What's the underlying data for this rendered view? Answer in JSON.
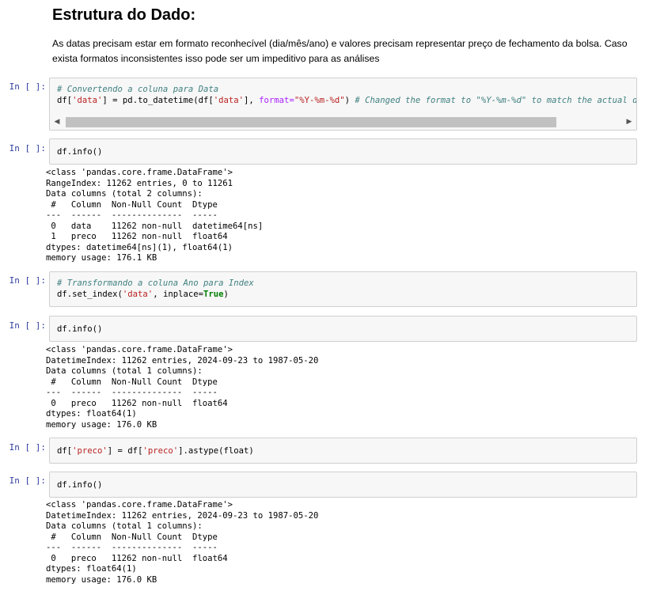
{
  "markdown": {
    "heading": "Estrutura do Dado:",
    "paragraph": "As datas precisam estar em formato reconhecível (dia/mês/ano) e valores precisam representar preço de fechamento da bolsa. Caso exista formatos inconsistentes isso pode ser um impeditivo para as análises"
  },
  "cells": [
    {
      "prompt": "In [ ]:",
      "comment": "# Convertendo a coluna para Data",
      "line2_a": "df[",
      "line2_s1": "'data'",
      "line2_b": "] = pd.to_datetime(df[",
      "line2_s2": "'data'",
      "line2_c": "], ",
      "line2_kw": "format=",
      "line2_s3": "\"%Y-%m-%d\"",
      "line2_d": ") ",
      "line2_comment": "# Changed the format to \"%Y-%m-%d\" to match the actual date format"
    },
    {
      "prompt": "In [ ]:",
      "code": "df.info()",
      "output": "<class 'pandas.core.frame.DataFrame'>\nRangeIndex: 11262 entries, 0 to 11261\nData columns (total 2 columns):\n #   Column  Non-Null Count  Dtype\n---  ------  --------------  -----\n 0   data    11262 non-null  datetime64[ns]\n 1   preco   11262 non-null  float64\ndtypes: datetime64[ns](1), float64(1)\nmemory usage: 176.1 KB"
    },
    {
      "prompt": "In [ ]:",
      "comment": "# Transformando a coluna Ano para Index",
      "line2_a": "df.set_index(",
      "line2_s1": "'data'",
      "line2_b": ", inplace=",
      "line2_bool": "True",
      "line2_c": ")"
    },
    {
      "prompt": "In [ ]:",
      "code": "df.info()",
      "output": "<class 'pandas.core.frame.DataFrame'>\nDatetimeIndex: 11262 entries, 2024-09-23 to 1987-05-20\nData columns (total 1 columns):\n #   Column  Non-Null Count  Dtype\n---  ------  --------------  -----\n 0   preco   11262 non-null  float64\ndtypes: float64(1)\nmemory usage: 176.0 KB"
    },
    {
      "prompt": "In [ ]:",
      "line_a": "df[",
      "line_s1": "'preco'",
      "line_b": "] = df[",
      "line_s2": "'preco'",
      "line_c": "].astype(float)"
    },
    {
      "prompt": "In [ ]:",
      "code": "df.info()",
      "output": "<class 'pandas.core.frame.DataFrame'>\nDatetimeIndex: 11262 entries, 2024-09-23 to 1987-05-20\nData columns (total 1 columns):\n #   Column  Non-Null Count  Dtype\n---  ------  --------------  -----\n 0   preco   11262 non-null  float64\ndtypes: float64(1)\nmemory usage: 176.0 KB"
    }
  ],
  "icons": {
    "scroll_left": "triangle-left-icon",
    "scroll_right": "triangle-right-icon"
  }
}
